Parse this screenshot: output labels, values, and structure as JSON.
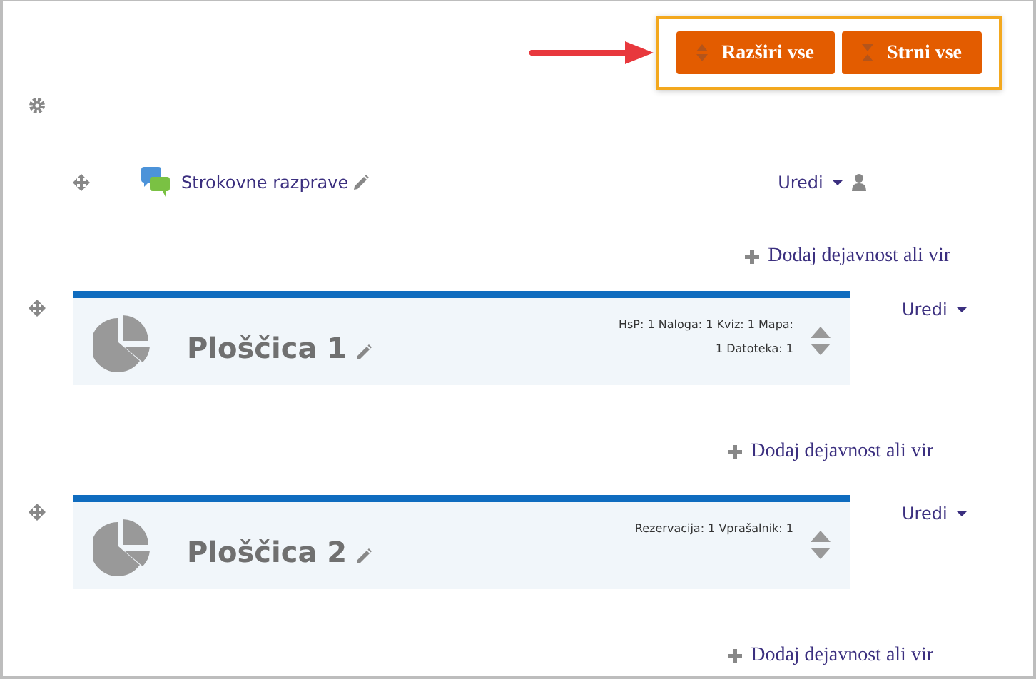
{
  "toolbar": {
    "highlighted": true,
    "buttons": [
      {
        "label": "Razširi vse",
        "kind": "expand"
      },
      {
        "label": "Strni vse",
        "kind": "collapse"
      }
    ]
  },
  "activity": {
    "name": "Strokovne razprave",
    "menu": "Uredi"
  },
  "sections": [
    {
      "kind": "add",
      "label": "Dodaj dejavnost ali vir"
    },
    {
      "kind": "tile",
      "title": "Ploščica 1",
      "summary": "HsP: 1 Naloga: 1 Kviz: 1 Mapa: 1 Datoteka: 1",
      "menu": "Uredi"
    },
    {
      "kind": "add",
      "label": "Dodaj dejavnost ali vir"
    },
    {
      "kind": "tile",
      "title": "Ploščica 2",
      "summary": "Rezervacija: 1 Vprašalnik: 1",
      "menu": "Uredi"
    },
    {
      "kind": "add",
      "label": "Dodaj dejavnost ali vir"
    }
  ]
}
